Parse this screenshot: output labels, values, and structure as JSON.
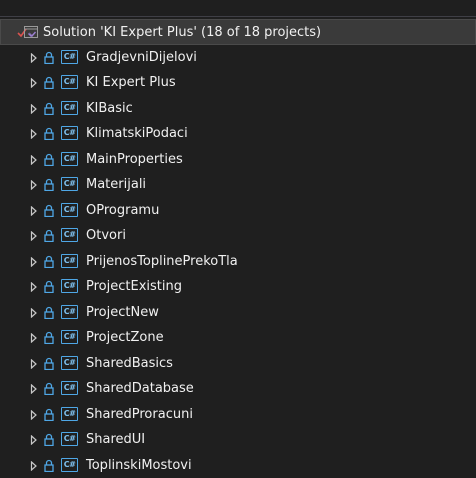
{
  "solution": {
    "label": "Solution 'KI Expert Plus' (18 of 18 projects)"
  },
  "icons": {
    "cs_glyph": "C#",
    "accent": "#4fa7e6",
    "check_color": "#d9534f",
    "solution_icon_color": "#9b7fd1"
  },
  "projects": [
    {
      "label": "GradjevniDijelovi"
    },
    {
      "label": "KI Expert Plus"
    },
    {
      "label": "KIBasic"
    },
    {
      "label": "KlimatskiPodaci"
    },
    {
      "label": "MainProperties"
    },
    {
      "label": "Materijali"
    },
    {
      "label": "OProgramu"
    },
    {
      "label": "Otvori"
    },
    {
      "label": "PrijenosToplinePrekoTla"
    },
    {
      "label": "ProjectExisting"
    },
    {
      "label": "ProjectNew"
    },
    {
      "label": "ProjectZone"
    },
    {
      "label": "SharedBasics"
    },
    {
      "label": "SharedDatabase"
    },
    {
      "label": "SharedProracuni"
    },
    {
      "label": "SharedUI"
    },
    {
      "label": "ToplinskiMostovi"
    }
  ]
}
